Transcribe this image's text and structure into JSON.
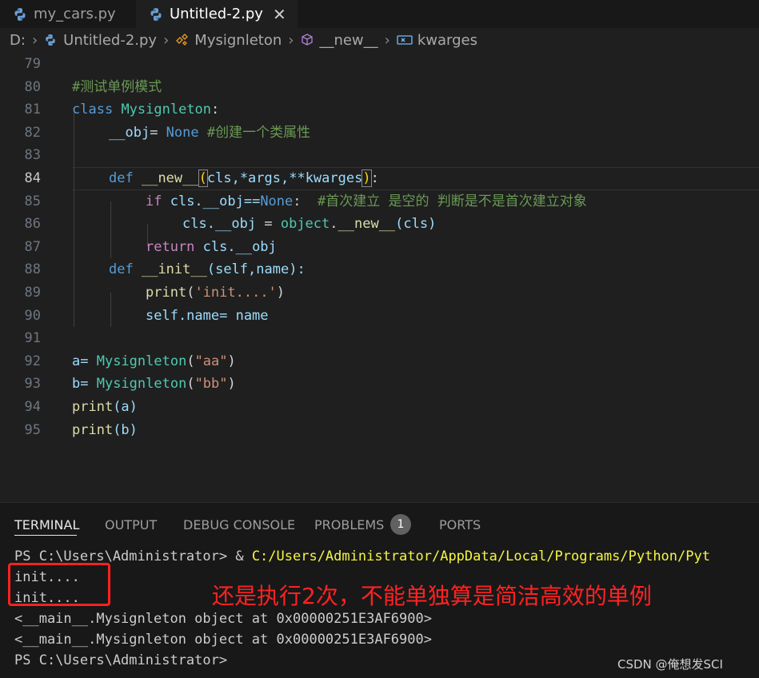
{
  "tabs": [
    {
      "label": "my_cars.py",
      "active": false
    },
    {
      "label": "Untitled-2.py",
      "active": true,
      "close": "✕"
    }
  ],
  "breadcrumb": {
    "drive": "D:",
    "file": "Untitled-2.py",
    "class": "Mysignleton",
    "method": "__new__",
    "param": "kwarges"
  },
  "editor": {
    "line_numbers": [
      "79",
      "80",
      "81",
      "82",
      "83",
      "84",
      "85",
      "86",
      "87",
      "88",
      "89",
      "90",
      "91",
      "92",
      "93",
      "94",
      "95"
    ],
    "active_line": "84",
    "lines": {
      "l80_comment": "#测试单例模式",
      "l81_kw": "class",
      "l81_name": "Mysignleton",
      "l81_colon": ":",
      "l82_attr": "__obj",
      "l82_eq": "= ",
      "l82_none": "None",
      "l82_comment": " #创建一个类属性",
      "l84_def": "def",
      "l84_fn": "__new__",
      "l84_open": "(",
      "l84_params": "cls,*args,**kwarges",
      "l84_close": ")",
      "l84_colon": ":",
      "l85_if": "if",
      "l85_expr": " cls.__obj==",
      "l85_none": "None",
      "l85_colon": ":  ",
      "l85_comment": "#首次建立 是空的 判断是不是首次建立对象",
      "l86_lhs": "cls.__obj",
      "l86_eq": " = ",
      "l86_obj": "object",
      "l86_dot": ".",
      "l86_fn": "__new__",
      "l86_args": "(cls)",
      "l87_ret": "return",
      "l87_expr": " cls.__obj",
      "l88_def": "def",
      "l88_fn": "__init__",
      "l88_args": "(self,name):",
      "l89_print": "print",
      "l89_open": "(",
      "l89_str": "'init....'",
      "l89_close": ")",
      "l90_code": "self.name= name",
      "l92_var": "a= ",
      "l92_cls": "Mysignleton",
      "l92_open": "(",
      "l92_str": "\"aa\"",
      "l92_close": ")",
      "l93_var": "b= ",
      "l93_cls": "Mysignleton",
      "l93_open": "(",
      "l93_str": "\"bb\"",
      "l93_close": ")",
      "l94_print": "print",
      "l94_args": "(a)",
      "l95_print": "print",
      "l95_args": "(b)"
    }
  },
  "panel": {
    "tabs": [
      "TERMINAL",
      "OUTPUT",
      "DEBUG CONSOLE",
      "PROBLEMS",
      "PORTS"
    ],
    "problems_count": "1",
    "terminal": {
      "prompt_cmd": "PS C:\\Users\\Administrator> & ",
      "prompt_path": "C:/Users/Administrator/AppData/Local/Programs/Python/Pyt",
      "out1": "init....",
      "out2": "init....",
      "obj1": "<__main__.Mysignleton object at 0x00000251E3AF6900>",
      "obj2": "<__main__.Mysignleton object at 0x00000251E3AF6900>",
      "prompt_end": "PS C:\\Users\\Administrator>"
    }
  },
  "annotation": "还是执行2次，不能单独算是简洁高效的单例",
  "watermark": "CSDN @俺想发SCI",
  "colors": {
    "keyword": "#569cd6",
    "function": "#dcdcaa",
    "comment": "#6a9955",
    "class": "#4ec9b0",
    "string": "#ce9178",
    "annotation": "#ff2222"
  }
}
